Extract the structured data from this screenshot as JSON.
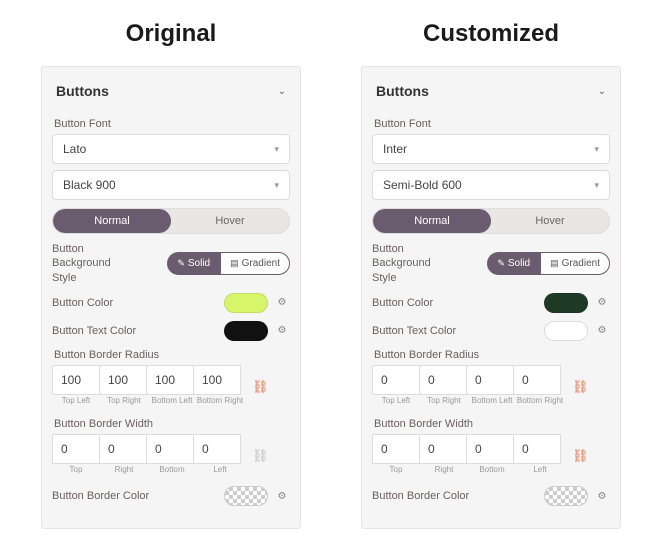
{
  "original": {
    "title": "Original",
    "panel_title": "Buttons",
    "font_label": "Button Font",
    "font_family": "Lato",
    "font_weight": "Black 900",
    "toggle": {
      "normal": "Normal",
      "hover": "Hover"
    },
    "bg_style_label": "Button\nBackground\nStyle",
    "pill_solid": "Solid",
    "pill_gradient": "Gradient",
    "color_label": "Button Color",
    "color_value": "#d6f56b",
    "text_color_label": "Button Text Color",
    "text_color_value": "#111111",
    "radius_label": "Button Border Radius",
    "radius_values": [
      "100",
      "100",
      "100",
      "100"
    ],
    "radius_sublabels": [
      "Top Left",
      "Top Right",
      "Bottom Left",
      "Bottom Right"
    ],
    "radius_linked": true,
    "width_label": "Button Border Width",
    "width_values": [
      "0",
      "0",
      "0",
      "0"
    ],
    "width_sublabels": [
      "Top",
      "Right",
      "Bottom",
      "Left"
    ],
    "width_linked": false,
    "border_color_label": "Button Border Color"
  },
  "customized": {
    "title": "Customized",
    "panel_title": "Buttons",
    "font_label": "Button Font",
    "font_family": "Inter",
    "font_weight": "Semi-Bold 600",
    "toggle": {
      "normal": "Normal",
      "hover": "Hover"
    },
    "bg_style_label": "Button\nBackground\nStyle",
    "pill_solid": "Solid",
    "pill_gradient": "Gradient",
    "color_label": "Button Color",
    "color_value": "#1e3a26",
    "text_color_label": "Button Text Color",
    "text_color_value": "#ffffff",
    "radius_label": "Button Border Radius",
    "radius_values": [
      "0",
      "0",
      "0",
      "0"
    ],
    "radius_sublabels": [
      "Top Left",
      "Top Right",
      "Bottom Left",
      "Bottom Right"
    ],
    "radius_linked": true,
    "width_label": "Button Border Width",
    "width_values": [
      "0",
      "0",
      "0",
      "0"
    ],
    "width_sublabels": [
      "Top",
      "Right",
      "Bottom",
      "Left"
    ],
    "width_linked": true,
    "border_color_label": "Button Border Color"
  }
}
